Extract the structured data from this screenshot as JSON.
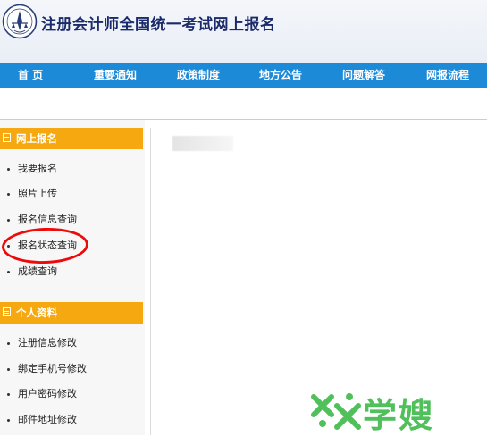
{
  "header": {
    "title": "注册会计师全国统一考试网上报名",
    "logo_icon": "cicpa-emblem-icon"
  },
  "nav": {
    "items": [
      "首 页",
      "重要通知",
      "政策制度",
      "地方公告",
      "问题解答",
      "网报流程"
    ]
  },
  "sidebar": {
    "sections": [
      {
        "title": "网上报名",
        "items": [
          "我要报名",
          "照片上传",
          "报名信息查询",
          "报名状态查询",
          "成绩查询"
        ]
      },
      {
        "title": "个人资料",
        "items": [
          "注册信息修改",
          "绑定手机号修改",
          "用户密码修改",
          "邮件地址修改"
        ]
      }
    ],
    "highlighted_item": "报名状态查询"
  },
  "watermark": {
    "text": "学嫂",
    "color": "#4fc05a"
  },
  "colors": {
    "nav_bg": "#1d8ad8",
    "section_head_bg": "#f6a810",
    "highlight_circle": "#ee0a0a"
  }
}
